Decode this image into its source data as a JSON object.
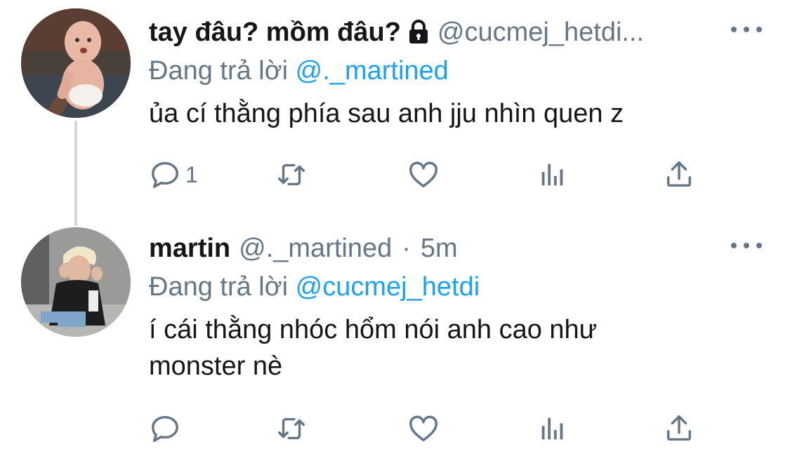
{
  "tweets": [
    {
      "name": "tay đâu? mồm đâu?",
      "handle": "@cucmej_hetdi...",
      "replying_prefix": "Đang trả lời",
      "replying_to": "@._martined",
      "text": "ủa cí thằng phía sau anh jju nhìn quen z",
      "reply_count": "1",
      "locked": true,
      "avatar_icon": "baby-avatar-icon"
    },
    {
      "name": "martin",
      "handle": "@._martined",
      "separator": "·",
      "time": "5m",
      "replying_prefix": "Đang trả lời",
      "replying_to": "@cucmej_hetdi",
      "text_lines": [
        "í cái thằng nhóc hổm nói anh cao như",
        "monster nè"
      ],
      "avatar_icon": "person-avatar-icon"
    }
  ],
  "colors": {
    "text": "#14171a",
    "secondary": "#657786",
    "link": "#1da1f2",
    "thread": "#cfd9de"
  },
  "icons": [
    "reply-icon",
    "retweet-icon",
    "like-icon",
    "analytics-icon",
    "share-icon",
    "more-icon",
    "lock-icon"
  ]
}
